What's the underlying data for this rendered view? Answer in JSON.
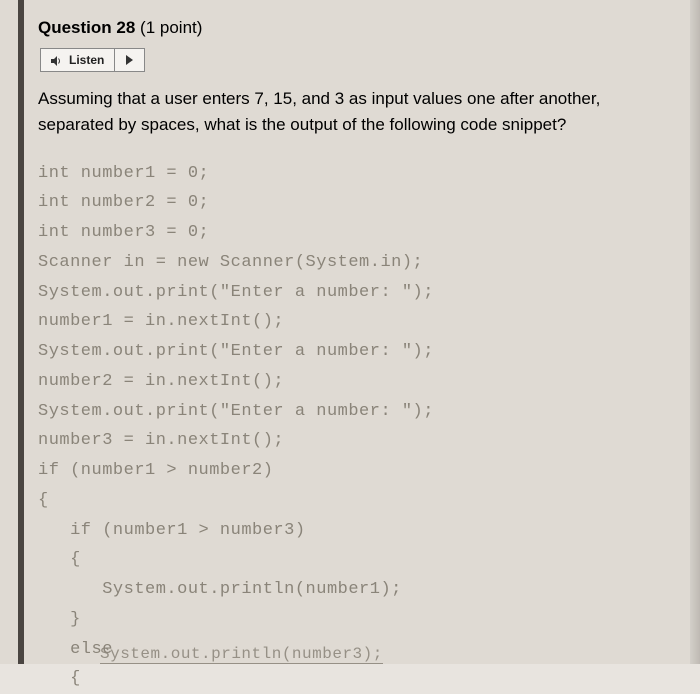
{
  "question": {
    "number_label": "Question 28",
    "points_label": "(1 point)",
    "listen_label": "Listen",
    "prompt": "Assuming that a user enters 7, 15, and 3 as input values one after another, separated by spaces, what is the output of the following code snippet?"
  },
  "code_lines": [
    "int number1 = 0;",
    "int number2 = 0;",
    "int number3 = 0;",
    "Scanner in = new Scanner(System.in);",
    "System.out.print(\"Enter a number: \");",
    "number1 = in.nextInt();",
    "System.out.print(\"Enter a number: \");",
    "number2 = in.nextInt();",
    "System.out.print(\"Enter a number: \");",
    "number3 = in.nextInt();",
    "if (number1 > number2)",
    "{",
    "   if (number1 > number3)",
    "   {",
    "      System.out.println(number1);",
    "   }",
    "   else",
    "   {"
  ],
  "code_last_partial": "System.out.println(number3);"
}
